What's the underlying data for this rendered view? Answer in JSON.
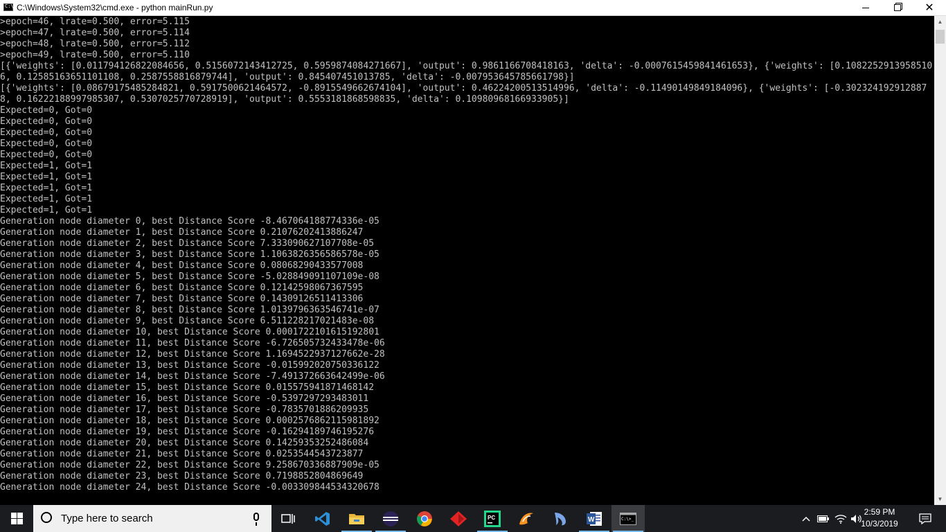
{
  "window": {
    "title": "C:\\Windows\\System32\\cmd.exe - python  mainRun.py",
    "app_icon": "cmd-icon"
  },
  "console": {
    "lines": [
      ">epoch=46, lrate=0.500, error=5.115",
      ">epoch=47, lrate=0.500, error=5.114",
      ">epoch=48, lrate=0.500, error=5.112",
      ">epoch=49, lrate=0.500, error=5.110",
      "[{'weights': [0.011794126822084656, 0.5156072143412725, 0.5959874084271667], 'output': 0.9861166708418163, 'delta': -0.0007615459841461653}, {'weights': [0.10822529139585106, 0.12585163651101108, 0.2587558816879744], 'output': 0.845407451013785, 'delta': -0.007953645785661798}]",
      "[{'weights': [0.08679175485284821, 0.5917500621464572, -0.8915549662674104], 'output': 0.46224200513514996, 'delta': -0.11490149849184096}, {'weights': [-0.3023241929128878, 0.16222188997985307, 0.5307025770728919], 'output': 0.5553181868598835, 'delta': 0.10980968166933905}]",
      "Expected=0, Got=0",
      "Expected=0, Got=0",
      "Expected=0, Got=0",
      "Expected=0, Got=0",
      "Expected=0, Got=0",
      "Expected=1, Got=1",
      "Expected=1, Got=1",
      "Expected=1, Got=1",
      "Expected=1, Got=1",
      "Expected=1, Got=1",
      "Generation node diameter 0, best Distance Score -8.467064188774336e-05",
      "Generation node diameter 1, best Distance Score 0.21076202413886247",
      "Generation node diameter 2, best Distance Score 7.333090627107708e-05",
      "Generation node diameter 3, best Distance Score 1.1063826356586578e-05",
      "Generation node diameter 4, best Distance Score 0.08068290433577008",
      "Generation node diameter 5, best Distance Score -5.028849091107109e-08",
      "Generation node diameter 6, best Distance Score 0.12142598067367595",
      "Generation node diameter 7, best Distance Score 0.14309126511413306",
      "Generation node diameter 8, best Distance Score 1.0139796363546741e-07",
      "Generation node diameter 9, best Distance Score 6.511228217021483e-08",
      "Generation node diameter 10, best Distance Score 0.0001722101615192801",
      "Generation node diameter 11, best Distance Score -6.726505732433478e-06",
      "Generation node diameter 12, best Distance Score 1.1694522937127662e-28",
      "Generation node diameter 13, best Distance Score -0.015992020750336122",
      "Generation node diameter 14, best Distance Score -7.491372663642499e-06",
      "Generation node diameter 15, best Distance Score 0.015575941871468142",
      "Generation node diameter 16, best Distance Score -0.5397297293483011",
      "Generation node diameter 17, best Distance Score -0.7835701886209935",
      "Generation node diameter 18, best Distance Score 0.0002576862115981892",
      "Generation node diameter 19, best Distance Score -0.16294189746195276",
      "Generation node diameter 20, best Distance Score 0.14259353252486084",
      "Generation node diameter 21, best Distance Score 0.0253544543723877",
      "Generation node diameter 22, best Distance Score 9.258670336887909e-05",
      "Generation node diameter 23, best Distance Score 0.7198852804869649",
      "Generation node diameter 24, best Distance Score -0.003309844534320678"
    ]
  },
  "taskbar": {
    "search_placeholder": "Type here to search",
    "pinned": [
      {
        "name": "task-view-icon"
      },
      {
        "name": "vscode-icon"
      },
      {
        "name": "file-explorer-icon"
      },
      {
        "name": "eclipse-icon"
      },
      {
        "name": "chrome-icon"
      },
      {
        "name": "red-diamond-app-icon"
      },
      {
        "name": "pycharm-icon"
      },
      {
        "name": "orange-swirl-app-icon"
      },
      {
        "name": "dolphin-app-icon"
      },
      {
        "name": "word-icon"
      },
      {
        "name": "cmd-icon"
      }
    ],
    "tray": {
      "time": "2:59 PM",
      "date": "10/3/2019"
    }
  },
  "colors": {
    "console_bg": "#000000",
    "console_fg": "#c0c0c0",
    "taskbar_bg": "#1a1c20",
    "active_indicator": "#76b9ed"
  }
}
